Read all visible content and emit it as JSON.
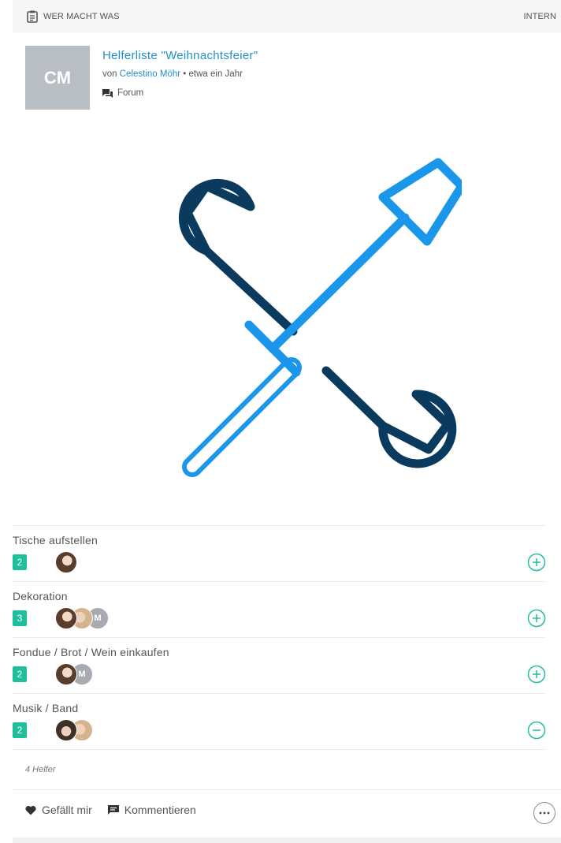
{
  "header": {
    "category": "WER MACHT WAS",
    "visibility": "INTERN"
  },
  "post": {
    "avatar_initials": "CM",
    "title": "Helferliste \"Weihnachtsfeier\"",
    "by_prefix": "von",
    "author": "Celestino Möhr",
    "time": "• etwa ein Jahr",
    "space": "Forum"
  },
  "tasks": [
    {
      "name": "Tische aufstellen",
      "count": "2",
      "action": "add"
    },
    {
      "name": "Dekoration",
      "count": "3",
      "action": "add",
      "initial": "M"
    },
    {
      "name": "Fondue / Brot / Wein einkaufen",
      "count": "2",
      "action": "add",
      "initial": "M"
    },
    {
      "name": "Musik / Band",
      "count": "2",
      "action": "remove"
    }
  ],
  "helpers_total": "4 Helfer",
  "footer": {
    "like": "Gefällt mir",
    "comment": "Kommentieren"
  },
  "colors": {
    "accent": "#1f90c9",
    "badge": "#1fbf9b",
    "icon_dark": "#0a3a5e",
    "icon_light": "#1a96ea"
  }
}
